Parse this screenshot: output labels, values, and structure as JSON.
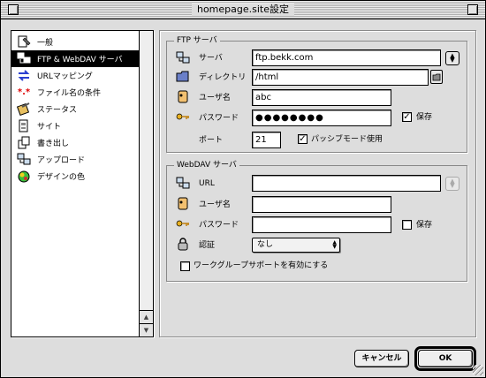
{
  "window": {
    "title": "homepage.site設定"
  },
  "sidebar": {
    "items": [
      {
        "label": "一般",
        "icon": "general-icon"
      },
      {
        "label": "FTP & WebDAV サーバ",
        "icon": "server-icon",
        "selected": true
      },
      {
        "label": "URLマッピング",
        "icon": "url-mapping-icon"
      },
      {
        "label": "ファイル名の条件",
        "icon": "filename-rule-icon"
      },
      {
        "label": "ステータス",
        "icon": "status-icon"
      },
      {
        "label": "サイト",
        "icon": "site-icon"
      },
      {
        "label": "書き出し",
        "icon": "export-icon"
      },
      {
        "label": "アップロード",
        "icon": "upload-icon"
      },
      {
        "label": "デザインの色",
        "icon": "design-color-icon"
      }
    ]
  },
  "ftp": {
    "group_title": "FTP サーバ",
    "server_label": "サーバ",
    "server_value": "ftp.bekk.com",
    "directory_label": "ディレクトリ",
    "directory_value": "/html",
    "user_label": "ユーザ名",
    "user_value": "abc",
    "password_label": "パスワード",
    "password_value": "●●●●●●●●",
    "save_label": "保存",
    "save_checked": true,
    "port_label": "ポート",
    "port_value": "21",
    "passive_label": "パッシブモード使用",
    "passive_checked": true
  },
  "webdav": {
    "group_title": "WebDAV サーバ",
    "url_label": "URL",
    "url_value": "",
    "user_label": "ユーザ名",
    "user_value": "",
    "password_label": "パスワード",
    "password_value": "",
    "save_label": "保存",
    "save_checked": false,
    "auth_label": "認証",
    "auth_value": "なし",
    "workgroup_label": "ワークグループサポートを有効にする",
    "workgroup_checked": false
  },
  "buttons": {
    "cancel": "キャンセル",
    "ok": "OK"
  }
}
